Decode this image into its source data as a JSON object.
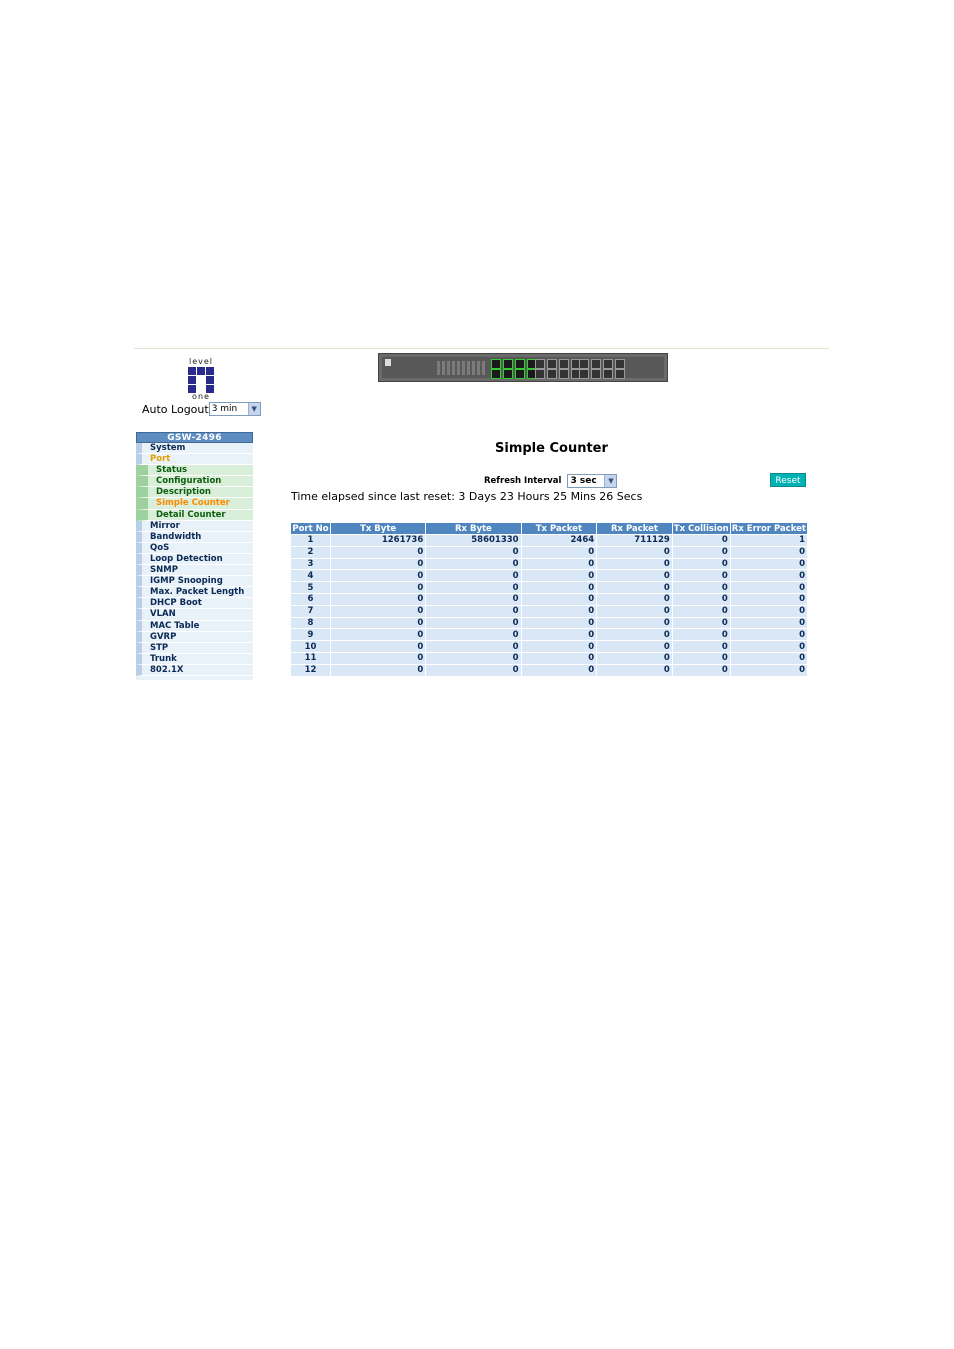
{
  "logo": {
    "top_text": "level",
    "bottom_text": "one"
  },
  "auto_logout": {
    "label": "Auto Logout",
    "value": "3 min"
  },
  "sidebar": {
    "device": "GSW-2496",
    "items": [
      {
        "label": "System",
        "type": "item"
      },
      {
        "label": "Port",
        "type": "item",
        "current": true
      },
      {
        "label": "Status",
        "type": "sub"
      },
      {
        "label": "Configuration",
        "type": "sub"
      },
      {
        "label": "Description",
        "type": "sub"
      },
      {
        "label": "Simple Counter",
        "type": "sub",
        "current": true
      },
      {
        "label": "Detail Counter",
        "type": "sub"
      },
      {
        "label": "Mirror",
        "type": "item"
      },
      {
        "label": "Bandwidth",
        "type": "item"
      },
      {
        "label": "QoS",
        "type": "item"
      },
      {
        "label": "Loop Detection",
        "type": "item"
      },
      {
        "label": "SNMP",
        "type": "item"
      },
      {
        "label": "IGMP Snooping",
        "type": "item"
      },
      {
        "label": "Max. Packet Length",
        "type": "item"
      },
      {
        "label": "DHCP Boot",
        "type": "item"
      },
      {
        "label": "VLAN",
        "type": "item"
      },
      {
        "label": "MAC Table",
        "type": "item"
      },
      {
        "label": "GVRP",
        "type": "item"
      },
      {
        "label": "STP",
        "type": "item"
      },
      {
        "label": "Trunk",
        "type": "item"
      },
      {
        "label": "802.1X",
        "type": "item"
      }
    ]
  },
  "main": {
    "title": "Simple Counter",
    "refresh_label": "Refresh Interval",
    "refresh_value": "3 sec",
    "reset_label": "Reset",
    "elapsed": "Time elapsed since last reset: 3 Days 23 Hours 25 Mins 26 Secs",
    "table": {
      "headers": [
        "Port No",
        "Tx Byte",
        "Rx Byte",
        "Tx Packet",
        "Rx Packet",
        "Tx Collision",
        "Rx Error Packet"
      ],
      "rows": [
        [
          "1",
          "1261736",
          "58601330",
          "2464",
          "711129",
          "0",
          "1"
        ],
        [
          "2",
          "0",
          "0",
          "0",
          "0",
          "0",
          "0"
        ],
        [
          "3",
          "0",
          "0",
          "0",
          "0",
          "0",
          "0"
        ],
        [
          "4",
          "0",
          "0",
          "0",
          "0",
          "0",
          "0"
        ],
        [
          "5",
          "0",
          "0",
          "0",
          "0",
          "0",
          "0"
        ],
        [
          "6",
          "0",
          "0",
          "0",
          "0",
          "0",
          "0"
        ],
        [
          "7",
          "0",
          "0",
          "0",
          "0",
          "0",
          "0"
        ],
        [
          "8",
          "0",
          "0",
          "0",
          "0",
          "0",
          "0"
        ],
        [
          "9",
          "0",
          "0",
          "0",
          "0",
          "0",
          "0"
        ],
        [
          "10",
          "0",
          "0",
          "0",
          "0",
          "0",
          "0"
        ],
        [
          "11",
          "0",
          "0",
          "0",
          "0",
          "0",
          "0"
        ],
        [
          "12",
          "0",
          "0",
          "0",
          "0",
          "0",
          "0"
        ]
      ]
    }
  },
  "colors": {
    "header_blue": "#4f86bf",
    "cell_blue": "#d9e7f6",
    "reset_teal": "#00b2b2",
    "current_orange": "#ff8a00"
  }
}
